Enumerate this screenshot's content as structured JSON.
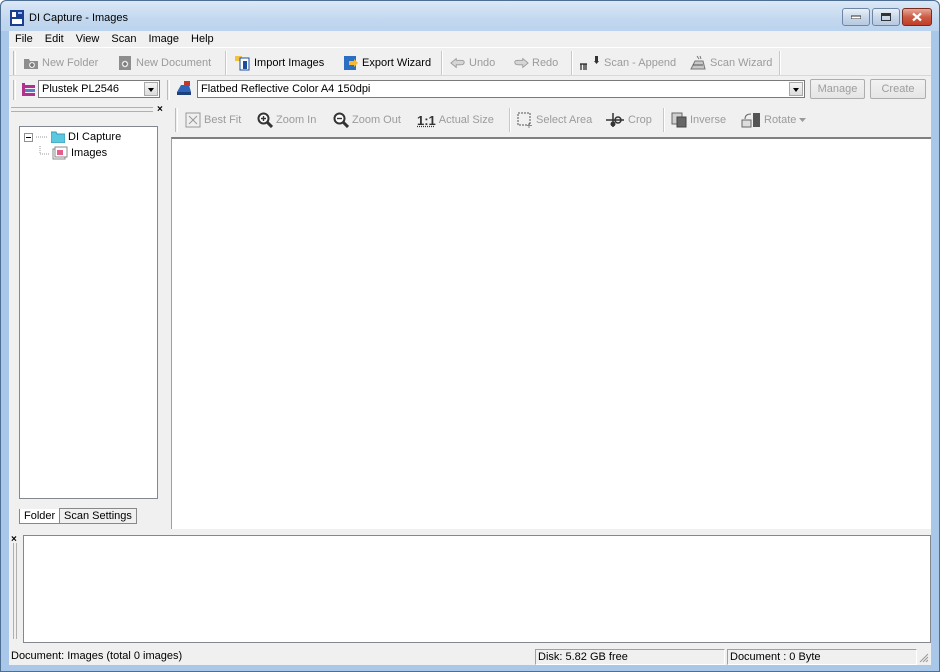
{
  "window": {
    "title": "DI Capture - Images",
    "controls": {
      "minimize": "minimize",
      "maximize": "maximize",
      "close": "close"
    }
  },
  "menubar": {
    "items": [
      {
        "label": "File"
      },
      {
        "label": "Edit"
      },
      {
        "label": "View"
      },
      {
        "label": "Scan"
      },
      {
        "label": "Image"
      },
      {
        "label": "Help"
      }
    ]
  },
  "main_toolbar": {
    "new_folder": {
      "label": "New Folder",
      "icon": "new-folder-icon",
      "enabled": false
    },
    "new_document": {
      "label": "New Document",
      "icon": "new-document-icon",
      "enabled": false
    },
    "import_images": {
      "label": "Import Images",
      "icon": "import-images-icon",
      "enabled": true
    },
    "export_wizard": {
      "label": "Export Wizard",
      "icon": "export-wizard-icon",
      "enabled": true
    },
    "undo": {
      "label": "Undo",
      "icon": "undo-icon",
      "enabled": false
    },
    "redo": {
      "label": "Redo",
      "icon": "redo-icon",
      "enabled": false
    },
    "scan_append": {
      "label": "Scan - Append",
      "icon": "scan-append-icon",
      "enabled": false
    },
    "scan_wizard": {
      "label": "Scan Wizard",
      "icon": "scan-wizard-icon",
      "enabled": false
    }
  },
  "scanner_toolbar": {
    "scanner": {
      "value": "Plustek PL2546"
    },
    "profile": {
      "value": "Flatbed Reflective Color A4 150dpi"
    },
    "manage_label": "Manage",
    "create_label": "Create"
  },
  "image_toolbar": {
    "best_fit": {
      "label": "Best Fit",
      "enabled": false
    },
    "zoom_in": {
      "label": "Zoom In",
      "enabled": false
    },
    "zoom_out": {
      "label": "Zoom Out",
      "enabled": false
    },
    "actual_size": {
      "label": "Actual Size",
      "glyph": "1:1",
      "enabled": false
    },
    "select_area": {
      "label": "Select Area",
      "enabled": false
    },
    "crop": {
      "label": "Crop",
      "enabled": false
    },
    "inverse": {
      "label": "Inverse",
      "enabled": false
    },
    "rotate": {
      "label": "Rotate",
      "enabled": false
    }
  },
  "left_panel": {
    "close_glyph": "×",
    "tree": [
      {
        "label": "DI Capture",
        "level": 0,
        "expanded": true
      },
      {
        "label": "Images",
        "level": 1
      }
    ],
    "tabs": [
      {
        "label": "Folder",
        "active": true
      },
      {
        "label": "Scan Settings",
        "active": false
      }
    ]
  },
  "bottom_panel": {
    "close_glyph": "×"
  },
  "statusbar": {
    "document": "Document: Images (total 0 images)",
    "disk": "Disk: 5.82 GB free",
    "size": "Document : 0 Byte"
  }
}
